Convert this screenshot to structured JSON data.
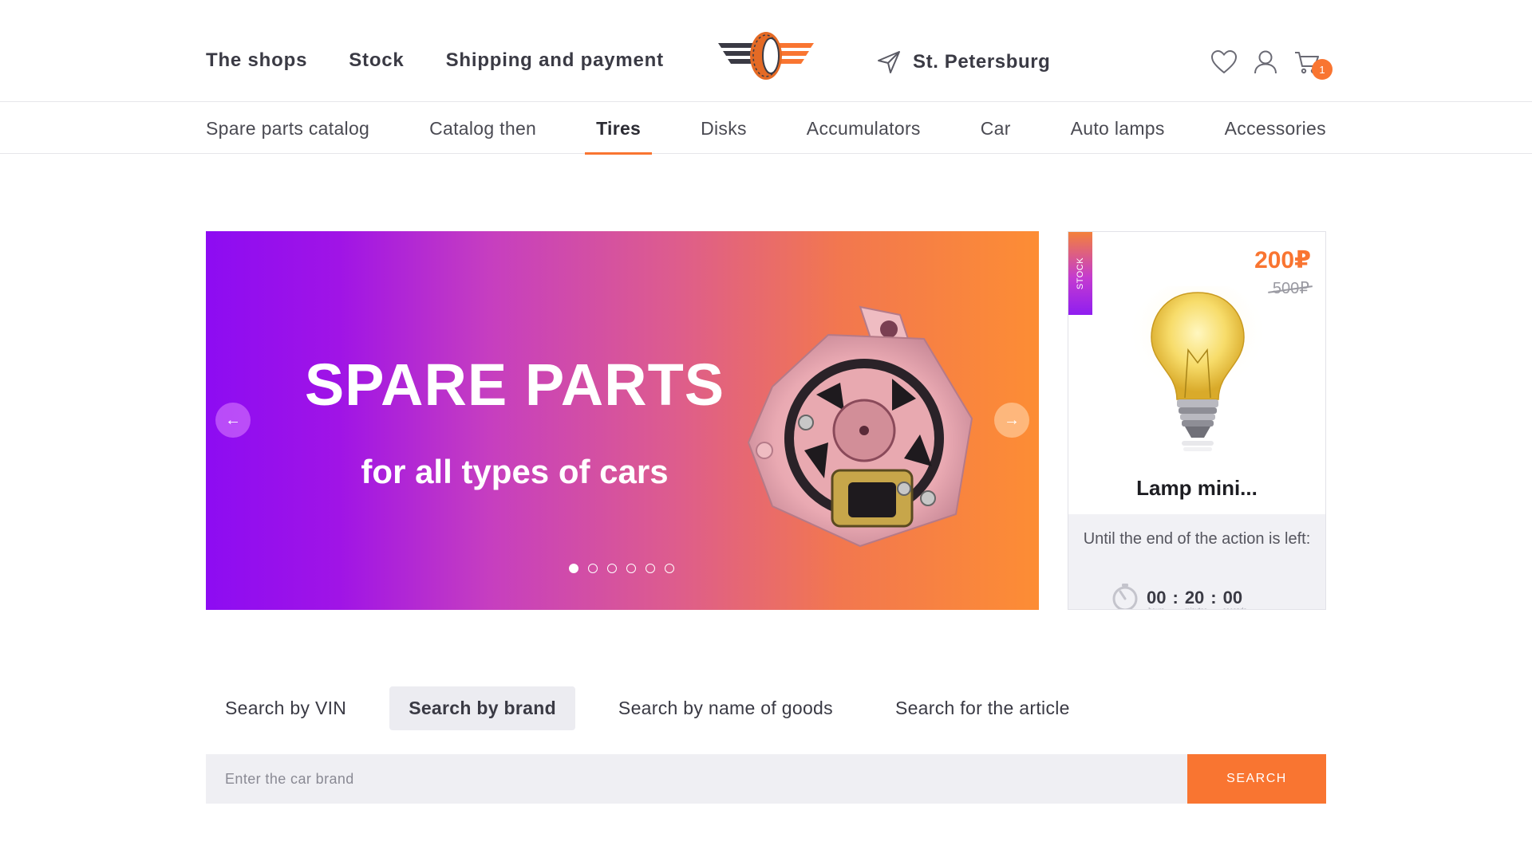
{
  "header": {
    "nav": [
      "The shops",
      "Stock",
      "Shipping and payment"
    ],
    "city": "St. Petersburg",
    "cart_count": "1",
    "icons": [
      "location-arrow-icon",
      "heart-icon",
      "user-icon",
      "cart-icon"
    ]
  },
  "categories": {
    "items": [
      "Spare parts catalog",
      "Catalog then",
      "Tires",
      "Disks",
      "Accumulators",
      "Car",
      "Auto lamps",
      "Accessories"
    ],
    "active": "Tires"
  },
  "slider": {
    "title": "SPARE PARTS",
    "subtitle": "for all types of cars",
    "slide_count": 6,
    "active_slide": 1,
    "prev_label": "←",
    "next_label": "→"
  },
  "promo": {
    "tag": "STOCK",
    "price_new": "200₽",
    "price_old": "500₽",
    "name": "Lamp mini...",
    "timer_label": "Until the end of the action is left:",
    "timer": {
      "hours": "00",
      "minutes": "20",
      "seconds": "00"
    },
    "timer_units": {
      "hours": "hours",
      "minutes": "minutes",
      "seconds": "seconds"
    }
  },
  "search": {
    "tabs": [
      "Search by VIN",
      "Search by brand",
      "Search by name of goods",
      "Search for the article"
    ],
    "active_tab": "Search by brand",
    "placeholder": "Enter the car brand",
    "value": "",
    "button": "SEARCH"
  },
  "colors": {
    "accent": "#f97531",
    "gradient_start": "#8d0cf2",
    "gradient_end": "#fd8d34",
    "text": "#3a3a44"
  }
}
